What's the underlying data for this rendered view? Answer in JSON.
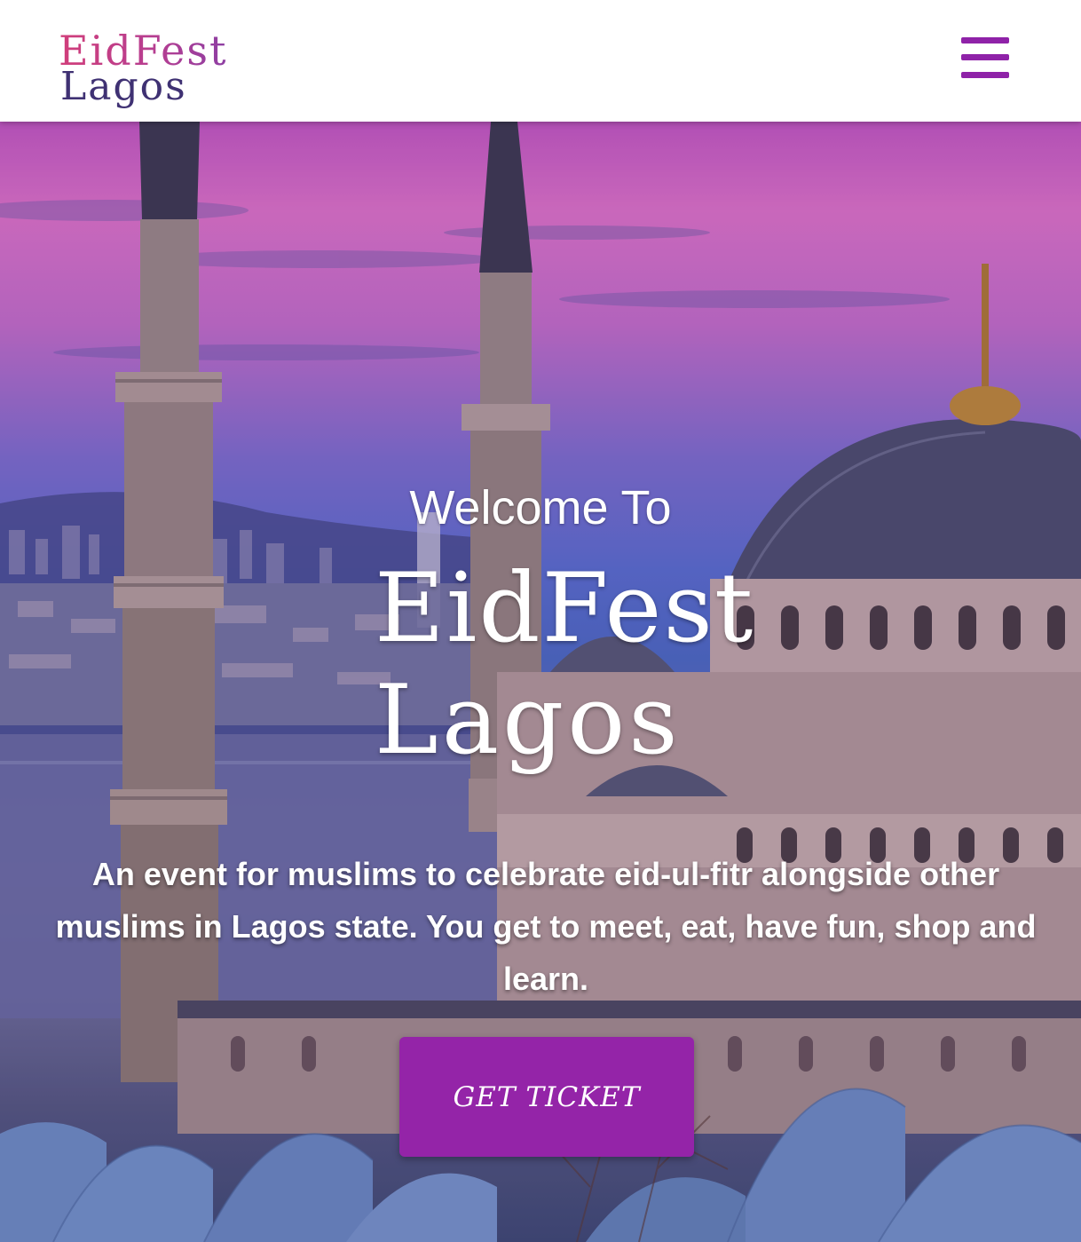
{
  "brand": {
    "logo_line1": "EidFest",
    "logo_line2": "Lagos"
  },
  "header": {
    "menu_icon": "hamburger-menu-icon"
  },
  "hero": {
    "welcome": "Welcome To",
    "logo_line1": "EidFest",
    "logo_line2": "Lagos",
    "tagline": "An event for muslims to celebrate eid-ul-fitr alongside other muslims in Lagos state. You get to meet, eat, have fun, shop and learn.",
    "cta_label": "GET TICKET",
    "background_image": "mosque at dusk with minarets and domes"
  },
  "colors": {
    "accent_purple": "#9424a8",
    "menu_purple": "#8f22a8",
    "logo_pink": "#c4367b",
    "logo_navy": "#3f3173"
  }
}
